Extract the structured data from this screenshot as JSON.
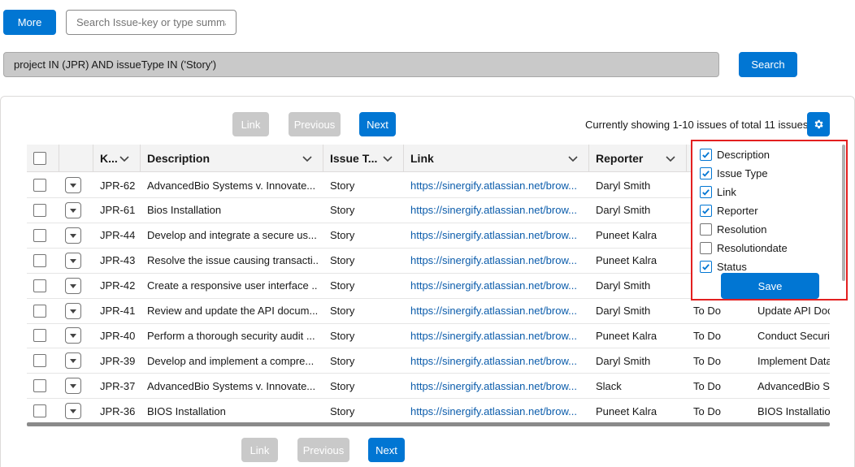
{
  "toolbar": {
    "more_label": "More",
    "search_placeholder": "Search Issue-key or type summary",
    "jql": "project IN (JPR) AND issueType IN ('Story')",
    "search_label": "Search"
  },
  "pagination": {
    "link_label": "Link",
    "previous_label": "Previous",
    "next_label": "Next",
    "showing_text": "Currently showing 1-10 issues of total 11 issues"
  },
  "columns": {
    "key": "K...",
    "description": "Description",
    "issue_type": "Issue T...",
    "link": "Link",
    "reporter": "Reporter"
  },
  "rows": [
    {
      "key": "JPR-62",
      "description": "AdvancedBio Systems v. Innovate...",
      "type": "Story",
      "link": "https://sinergify.atlassian.net/brow...",
      "reporter": "Daryl Smith",
      "status": "",
      "summary": ""
    },
    {
      "key": "JPR-61",
      "description": "Bios Installation",
      "type": "Story",
      "link": "https://sinergify.atlassian.net/brow...",
      "reporter": "Daryl Smith",
      "status": "",
      "summary": ""
    },
    {
      "key": "JPR-44",
      "description": "Develop and integrate a secure us...",
      "type": "Story",
      "link": "https://sinergify.atlassian.net/brow...",
      "reporter": "Puneet Kalra",
      "status": "",
      "summary": ""
    },
    {
      "key": "JPR-43",
      "description": "Resolve the issue causing transacti...",
      "type": "Story",
      "link": "https://sinergify.atlassian.net/brow...",
      "reporter": "Puneet Kalra",
      "status": "",
      "summary": ""
    },
    {
      "key": "JPR-42",
      "description": "Create a responsive user interface ...",
      "type": "Story",
      "link": "https://sinergify.atlassian.net/brow...",
      "reporter": "Daryl Smith",
      "status": "",
      "summary": ""
    },
    {
      "key": "JPR-41",
      "description": "Review and update the API docum...",
      "type": "Story",
      "link": "https://sinergify.atlassian.net/brow...",
      "reporter": "Daryl Smith",
      "status": "To Do",
      "summary": "Update API Doc"
    },
    {
      "key": "JPR-40",
      "description": "Perform a thorough security audit ...",
      "type": "Story",
      "link": "https://sinergify.atlassian.net/brow...",
      "reporter": "Puneet Kalra",
      "status": "To Do",
      "summary": "Conduct Securit"
    },
    {
      "key": "JPR-39",
      "description": "Develop and implement a compre...",
      "type": "Story",
      "link": "https://sinergify.atlassian.net/brow...",
      "reporter": "Daryl Smith",
      "status": "To Do",
      "summary": "Implement Data"
    },
    {
      "key": "JPR-37",
      "description": "AdvancedBio Systems v. Innovate...",
      "type": "Story",
      "link": "https://sinergify.atlassian.net/brow...",
      "reporter": "Slack",
      "status": "To Do",
      "summary": "AdvancedBio Sy"
    },
    {
      "key": "JPR-36",
      "description": "BIOS Installation",
      "type": "Story",
      "link": "https://sinergify.atlassian.net/brow...",
      "reporter": "Puneet Kalra",
      "status": "To Do",
      "summary": "BIOS Installation"
    }
  ],
  "column_chooser": {
    "options": [
      {
        "label": "Description",
        "checked": true
      },
      {
        "label": "Issue Type",
        "checked": true
      },
      {
        "label": "Link",
        "checked": true
      },
      {
        "label": "Reporter",
        "checked": true
      },
      {
        "label": "Resolution",
        "checked": false
      },
      {
        "label": "Resolutiondate",
        "checked": false
      },
      {
        "label": "Status",
        "checked": true
      }
    ],
    "save_label": "Save"
  },
  "colors": {
    "primary": "#0176d3",
    "disabled": "#c9c9c9",
    "link": "#0b5cab",
    "highlight_border": "#e32020"
  }
}
